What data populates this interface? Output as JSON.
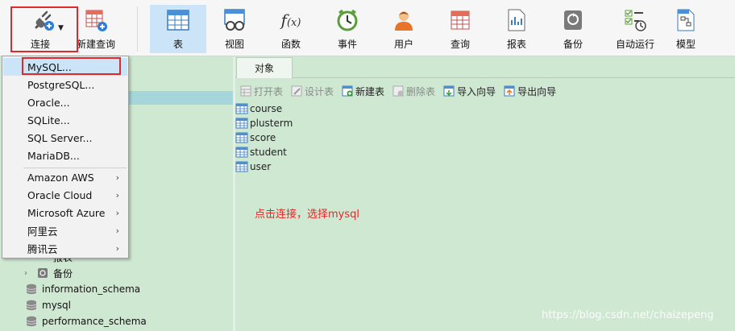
{
  "toolbar": {
    "items": [
      {
        "label": "连接",
        "icon": "plug-icon"
      },
      {
        "label": "新建查询",
        "icon": "new-query-icon"
      },
      {
        "label": "表",
        "icon": "table-icon"
      },
      {
        "label": "视图",
        "icon": "view-icon"
      },
      {
        "label": "函数",
        "icon": "function-icon"
      },
      {
        "label": "事件",
        "icon": "clock-icon"
      },
      {
        "label": "用户",
        "icon": "user-icon"
      },
      {
        "label": "查询",
        "icon": "query-icon"
      },
      {
        "label": "报表",
        "icon": "report-icon"
      },
      {
        "label": "备份",
        "icon": "backup-icon"
      },
      {
        "label": "自动运行",
        "icon": "automation-icon"
      },
      {
        "label": "模型",
        "icon": "model-icon"
      }
    ]
  },
  "connect_menu": {
    "items": [
      {
        "label": "MySQL...",
        "submenu": false
      },
      {
        "label": "PostgreSQL...",
        "submenu": false
      },
      {
        "label": "Oracle...",
        "submenu": false
      },
      {
        "label": "SQLite...",
        "submenu": false
      },
      {
        "label": "SQL Server...",
        "submenu": false
      },
      {
        "label": "MariaDB...",
        "submenu": false
      },
      {
        "label": "Amazon AWS",
        "submenu": true
      },
      {
        "label": "Oracle Cloud",
        "submenu": true
      },
      {
        "label": "Microsoft Azure",
        "submenu": true
      },
      {
        "label": "阿里云",
        "submenu": true
      },
      {
        "label": "腾讯云",
        "submenu": true
      }
    ],
    "submenu_arrow": "›"
  },
  "nav_tree": {
    "rows": [
      {
        "label": "报表",
        "type": "folder"
      },
      {
        "label": "备份",
        "type": "backup"
      },
      {
        "label": "information_schema",
        "type": "database"
      },
      {
        "label": "mysql",
        "type": "database"
      },
      {
        "label": "performance_schema",
        "type": "database"
      }
    ]
  },
  "tabs": [
    {
      "label": "对象"
    }
  ],
  "object_toolbar": [
    {
      "label": "打开表",
      "enabled": false
    },
    {
      "label": "设计表",
      "enabled": false
    },
    {
      "label": "新建表",
      "enabled": true
    },
    {
      "label": "删除表",
      "enabled": false
    },
    {
      "label": "导入向导",
      "enabled": true
    },
    {
      "label": "导出向导",
      "enabled": true
    }
  ],
  "tables": [
    "course",
    "plusterm",
    "score",
    "student",
    "user"
  ],
  "annotation": "点击连接，选择mysql",
  "watermark": "https://blog.csdn.net/chaizepeng",
  "colors": {
    "background": "#cfe8d2",
    "highlight": "#cce4f7",
    "annotation_red": "#e0292b"
  }
}
